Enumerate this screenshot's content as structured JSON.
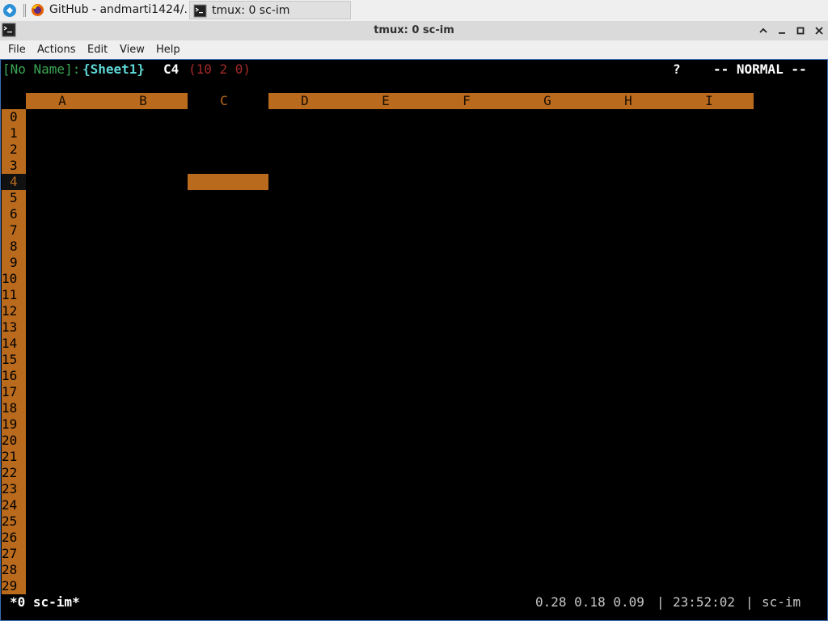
{
  "taskbar": {
    "tasks": [
      {
        "label": "GitHub - andmarti1424/..."
      },
      {
        "label": "tmux: 0 sc-im"
      }
    ]
  },
  "window": {
    "title": "tmux: 0 sc-im"
  },
  "menubar": {
    "items": [
      "File",
      "Actions",
      "Edit",
      "View",
      "Help"
    ]
  },
  "scim": {
    "filename": "[No Name]:",
    "sheet": "{Sheet1}",
    "cell": "C4",
    "cell_info": "(10 2 0)",
    "help_mark": "?",
    "mode": "-- NORMAL --",
    "columns": [
      "A",
      "B",
      "C",
      "D",
      "E",
      "F",
      "G",
      "H",
      "I"
    ],
    "current_column": "C",
    "rows": [
      "0",
      "1",
      "2",
      "3",
      "4",
      "5",
      "6",
      "7",
      "8",
      "9",
      "10",
      "11",
      "12",
      "13",
      "14",
      "15",
      "16",
      "17",
      "18",
      "19",
      "20",
      "21",
      "22",
      "23",
      "24",
      "25",
      "26",
      "27",
      "28",
      "29"
    ],
    "current_row": "4"
  },
  "tmux": {
    "window_list": "*0 sc-im*",
    "load": "0.28 0.18 0.09",
    "sep1": "|",
    "clock": "23:52:02",
    "sep2": "|",
    "session": "sc-im"
  },
  "colors": {
    "header": "#b96a1d",
    "filename": "#3aa655",
    "sheet": "#5fd7d7",
    "cell_info": "#a52a2a",
    "frame": "#3b6fb6"
  },
  "icons": [
    "kde-start-icon",
    "firefox-icon",
    "terminal-icon",
    "maximize-icon",
    "minimize-icon",
    "restore-icon",
    "close-icon"
  ]
}
